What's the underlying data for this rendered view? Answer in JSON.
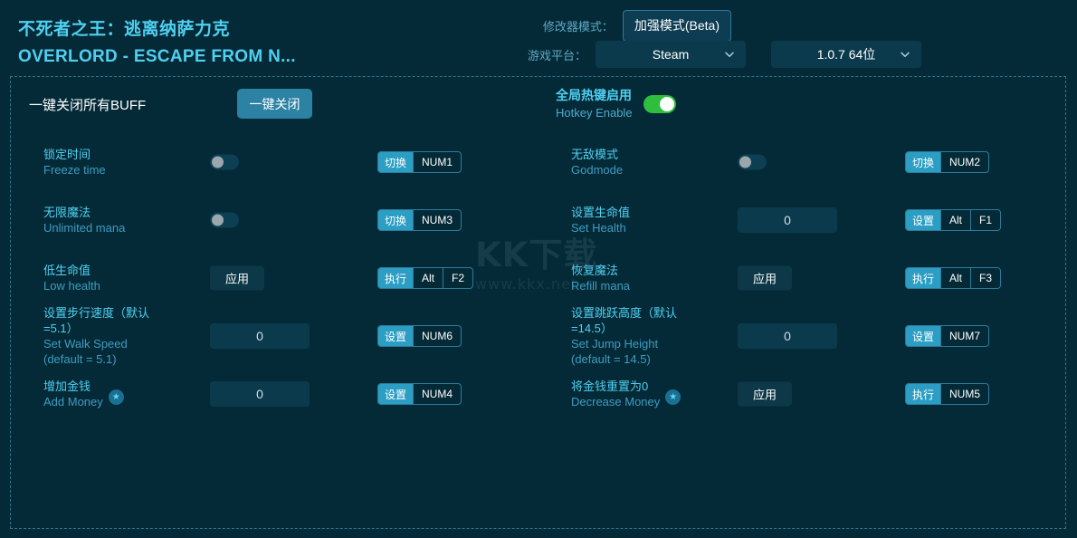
{
  "header": {
    "title_cn": "不死者之王：逃离纳萨力克",
    "title_en": "OVERLORD - ESCAPE FROM N...",
    "mode_label": "修改器模式：",
    "mode_button": "加强模式(Beta)",
    "platform_label": "游戏平台：",
    "platform_value": "Steam",
    "version_value": "1.0.7 64位"
  },
  "topbar": {
    "buff_label": "一键关闭所有BUFF",
    "buff_button": "一键关闭",
    "hotkey_cn": "全局热键启用",
    "hotkey_en": "Hotkey Enable",
    "hotkey_enabled": true
  },
  "watermark": {
    "logo": "KK下载",
    "url": "www.kkx.net"
  },
  "cheats": {
    "left": [
      {
        "label_cn": "锁定时间",
        "label_en": "Freeze time",
        "star": false,
        "control": "toggle",
        "value": "",
        "toggle_on": false,
        "hotkey_action": "切换",
        "hotkey_keys": [
          "NUM1"
        ]
      },
      {
        "label_cn": "无限魔法",
        "label_en": "Unlimited mana",
        "star": false,
        "control": "toggle",
        "value": "",
        "toggle_on": false,
        "hotkey_action": "切换",
        "hotkey_keys": [
          "NUM3"
        ]
      },
      {
        "label_cn": "低生命值",
        "label_en": "Low health",
        "star": false,
        "control": "button",
        "value": "应用",
        "hotkey_action": "执行",
        "hotkey_keys": [
          "Alt",
          "F2"
        ]
      },
      {
        "label_cn": "设置步行速度（默认=5.1）",
        "label_en": "Set Walk Speed (default = 5.1)",
        "star": false,
        "control": "input",
        "value": "0",
        "hotkey_action": "设置",
        "hotkey_keys": [
          "NUM6"
        ]
      },
      {
        "label_cn": "增加金钱",
        "label_en": "Add Money",
        "star": true,
        "control": "input",
        "value": "0",
        "hotkey_action": "设置",
        "hotkey_keys": [
          "NUM4"
        ]
      }
    ],
    "right": [
      {
        "label_cn": "无敌模式",
        "label_en": "Godmode",
        "star": false,
        "control": "toggle",
        "value": "",
        "toggle_on": false,
        "hotkey_action": "切换",
        "hotkey_keys": [
          "NUM2"
        ]
      },
      {
        "label_cn": "设置生命值",
        "label_en": "Set Health",
        "star": false,
        "control": "input",
        "value": "0",
        "hotkey_action": "设置",
        "hotkey_keys": [
          "Alt",
          "F1"
        ]
      },
      {
        "label_cn": "恢复魔法",
        "label_en": "Refill mana",
        "star": false,
        "control": "button",
        "value": "应用",
        "hotkey_action": "执行",
        "hotkey_keys": [
          "Alt",
          "F3"
        ]
      },
      {
        "label_cn": "设置跳跃高度（默认=14.5）",
        "label_en": "Set Jump Height (default = 14.5)",
        "star": false,
        "control": "input",
        "value": "0",
        "hotkey_action": "设置",
        "hotkey_keys": [
          "NUM7"
        ]
      },
      {
        "label_cn": "将金钱重置为0",
        "label_en": "Decrease Money",
        "star": true,
        "control": "button",
        "value": "应用",
        "hotkey_action": "执行",
        "hotkey_keys": [
          "NUM5"
        ]
      }
    ]
  },
  "colors": {
    "background": "#042a38",
    "accent": "#4fd0f0",
    "button": "#2c82a3",
    "toggle_on": "#2dbe3e",
    "panel_border": "#2b7792"
  }
}
